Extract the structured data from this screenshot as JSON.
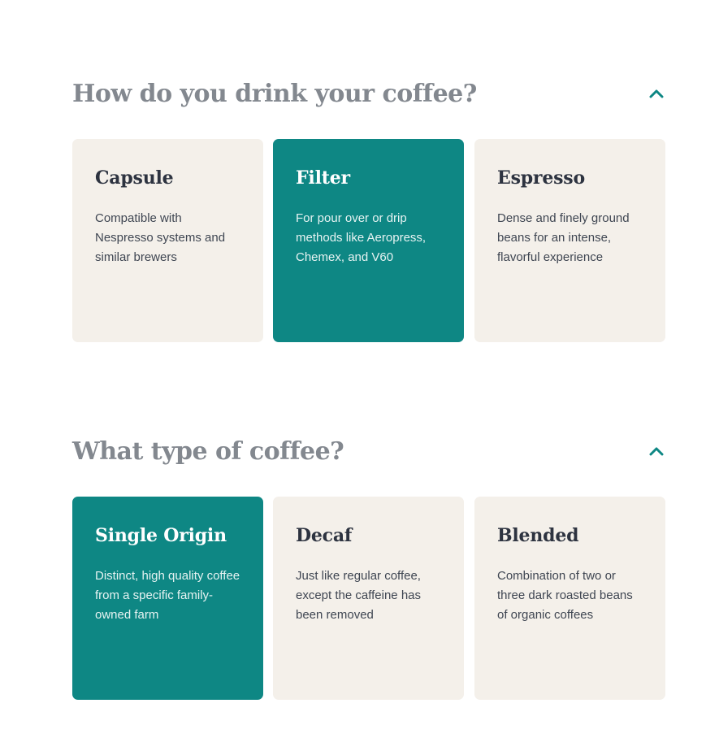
{
  "colors": {
    "accent": "#0e8784",
    "card_background": "#f4f0ea",
    "heading_gray": "#83888f",
    "text_dark": "#2d3340"
  },
  "sections": [
    {
      "title": "How do you drink your coffee?",
      "toggle_icon": "chevron-up-icon",
      "options": [
        {
          "title": "Capsule",
          "description": "Compatible with Nespresso systems and similar brewers",
          "selected": false
        },
        {
          "title": "Filter",
          "description": "For pour over or drip methods like Aeropress, Chemex, and V60",
          "selected": true
        },
        {
          "title": "Espresso",
          "description": "Dense and finely ground beans for an intense, flavorful experience",
          "selected": false
        }
      ]
    },
    {
      "title": "What type of coffee?",
      "toggle_icon": "chevron-up-icon",
      "options": [
        {
          "title": "Single Origin",
          "description": "Distinct, high quality coffee from a specific family-owned farm",
          "selected": true
        },
        {
          "title": "Decaf",
          "description": "Just like regular coffee, except the caffeine has been removed",
          "selected": false
        },
        {
          "title": "Blended",
          "description": "Combination of two or three dark roasted beans of organic coffees",
          "selected": false
        }
      ]
    }
  ]
}
